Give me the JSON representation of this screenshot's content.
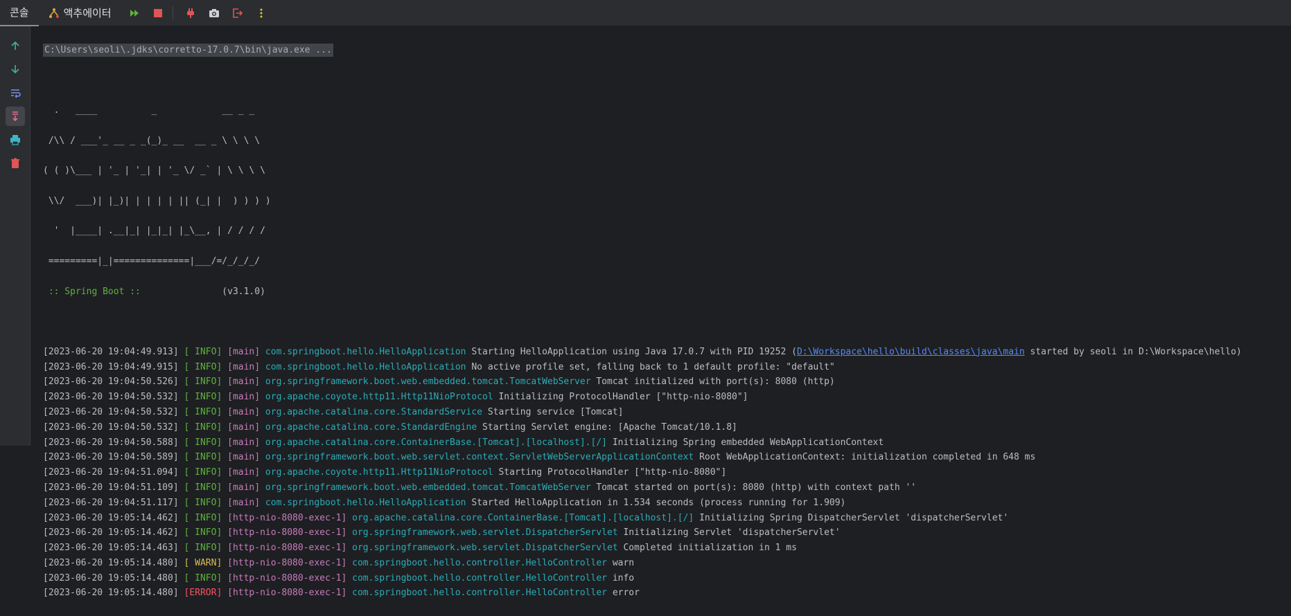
{
  "toolbar": {
    "tab_console": "콘솔",
    "tab_actuator": "액추에이터",
    "icons": [
      "rerun-icon",
      "stop-icon",
      "plug-icon",
      "camera-icon",
      "exit-icon",
      "more-icon"
    ]
  },
  "gutter": {
    "icons": [
      "arrow-up-icon",
      "arrow-down-icon",
      "soft-wrap-icon",
      "scroll-to-end-icon",
      "print-icon",
      "trash-icon"
    ]
  },
  "console": {
    "command": "C:\\Users\\seoli\\.jdks\\corretto-17.0.7\\bin\\java.exe ...",
    "banner": [
      "  .   ____          _            __ _ _",
      " /\\\\ / ___'_ __ _ _(_)_ __  __ _ \\ \\ \\ \\",
      "( ( )\\___ | '_ | '_| | '_ \\/ _` | \\ \\ \\ \\",
      " \\\\/  ___)| |_)| | | | | || (_| |  ) ) ) )",
      "  '  |____| .__|_| |_|_| |_\\__, | / / / /",
      " =========|_|==============|___/=/_/_/_/"
    ],
    "spring_label": " :: Spring Boot :: ",
    "spring_version": "              (v3.1.0)",
    "logs": [
      {
        "ts": "[2023-06-20 19:04:49.913]",
        "level": "[ INFO]",
        "lv": "info",
        "thread": "[main]",
        "logger": "com.springboot.hello.HelloApplication",
        "msg": "Starting HelloApplication using Java 17.0.7 with PID 19252 (",
        "link": "D:\\Workspace\\hello\\build\\classes\\java\\main",
        "msg2": " started by seoli in D:\\Workspace\\hello)"
      },
      {
        "ts": "[2023-06-20 19:04:49.915]",
        "level": "[ INFO]",
        "lv": "info",
        "thread": "[main]",
        "logger": "com.springboot.hello.HelloApplication",
        "msg": "No active profile set, falling back to 1 default profile: \"default\""
      },
      {
        "ts": "[2023-06-20 19:04:50.526]",
        "level": "[ INFO]",
        "lv": "info",
        "thread": "[main]",
        "logger": "org.springframework.boot.web.embedded.tomcat.TomcatWebServer",
        "msg": "Tomcat initialized with port(s): 8080 (http)"
      },
      {
        "ts": "[2023-06-20 19:04:50.532]",
        "level": "[ INFO]",
        "lv": "info",
        "thread": "[main]",
        "logger": "org.apache.coyote.http11.Http11NioProtocol",
        "msg": "Initializing ProtocolHandler [\"http-nio-8080\"]"
      },
      {
        "ts": "[2023-06-20 19:04:50.532]",
        "level": "[ INFO]",
        "lv": "info",
        "thread": "[main]",
        "logger": "org.apache.catalina.core.StandardService",
        "msg": "Starting service [Tomcat]"
      },
      {
        "ts": "[2023-06-20 19:04:50.532]",
        "level": "[ INFO]",
        "lv": "info",
        "thread": "[main]",
        "logger": "org.apache.catalina.core.StandardEngine",
        "msg": "Starting Servlet engine: [Apache Tomcat/10.1.8]"
      },
      {
        "ts": "[2023-06-20 19:04:50.588]",
        "level": "[ INFO]",
        "lv": "info",
        "thread": "[main]",
        "logger": "org.apache.catalina.core.ContainerBase.[Tomcat].[localhost].[/]",
        "msg": "Initializing Spring embedded WebApplicationContext"
      },
      {
        "ts": "[2023-06-20 19:04:50.589]",
        "level": "[ INFO]",
        "lv": "info",
        "thread": "[main]",
        "logger": "org.springframework.boot.web.servlet.context.ServletWebServerApplicationContext",
        "msg": "Root WebApplicationContext: initialization completed in 648 ms"
      },
      {
        "ts": "[2023-06-20 19:04:51.094]",
        "level": "[ INFO]",
        "lv": "info",
        "thread": "[main]",
        "logger": "org.apache.coyote.http11.Http11NioProtocol",
        "msg": "Starting ProtocolHandler [\"http-nio-8080\"]"
      },
      {
        "ts": "[2023-06-20 19:04:51.109]",
        "level": "[ INFO]",
        "lv": "info",
        "thread": "[main]",
        "logger": "org.springframework.boot.web.embedded.tomcat.TomcatWebServer",
        "msg": "Tomcat started on port(s): 8080 (http) with context path ''"
      },
      {
        "ts": "[2023-06-20 19:04:51.117]",
        "level": "[ INFO]",
        "lv": "info",
        "thread": "[main]",
        "logger": "com.springboot.hello.HelloApplication",
        "msg": "Started HelloApplication in 1.534 seconds (process running for 1.909)"
      },
      {
        "ts": "[2023-06-20 19:05:14.462]",
        "level": "[ INFO]",
        "lv": "info",
        "thread": "[http-nio-8080-exec-1]",
        "logger": "org.apache.catalina.core.ContainerBase.[Tomcat].[localhost].[/]",
        "msg": "Initializing Spring DispatcherServlet 'dispatcherServlet'"
      },
      {
        "ts": "[2023-06-20 19:05:14.462]",
        "level": "[ INFO]",
        "lv": "info",
        "thread": "[http-nio-8080-exec-1]",
        "logger": "org.springframework.web.servlet.DispatcherServlet",
        "msg": "Initializing Servlet 'dispatcherServlet'"
      },
      {
        "ts": "[2023-06-20 19:05:14.463]",
        "level": "[ INFO]",
        "lv": "info",
        "thread": "[http-nio-8080-exec-1]",
        "logger": "org.springframework.web.servlet.DispatcherServlet",
        "msg": "Completed initialization in 1 ms"
      },
      {
        "ts": "[2023-06-20 19:05:14.480]",
        "level": "[ WARN]",
        "lv": "warn",
        "thread": "[http-nio-8080-exec-1]",
        "logger": "com.springboot.hello.controller.HelloController",
        "msg": "warn"
      },
      {
        "ts": "[2023-06-20 19:05:14.480]",
        "level": "[ INFO]",
        "lv": "info",
        "thread": "[http-nio-8080-exec-1]",
        "logger": "com.springboot.hello.controller.HelloController",
        "msg": "info"
      },
      {
        "ts": "[2023-06-20 19:05:14.480]",
        "level": "[ERROR]",
        "lv": "error",
        "thread": "[http-nio-8080-exec-1]",
        "logger": "com.springboot.hello.controller.HelloController",
        "msg": "error"
      }
    ]
  }
}
